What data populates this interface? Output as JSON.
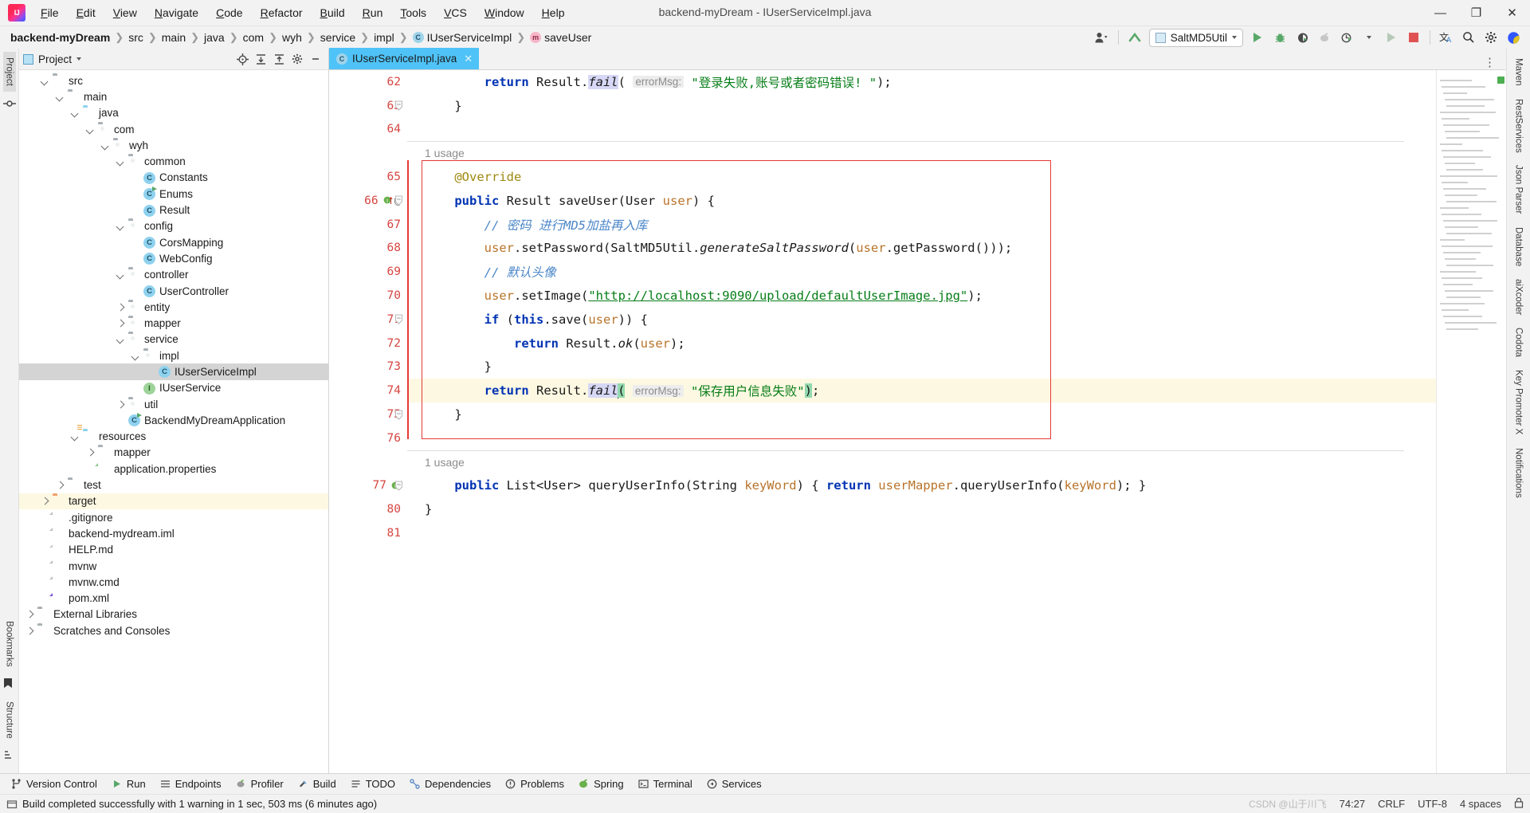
{
  "window": {
    "title": "backend-myDream - IUserServiceImpl.java",
    "logo_icon": "intellij-idea-logo",
    "minimize_icon": "minimize-icon",
    "maximize_icon": "maximize-icon",
    "close_icon": "close-icon",
    "minimize_glyph": "—",
    "maximize_glyph": "❐",
    "close_glyph": "✕"
  },
  "menubar": {
    "items": [
      "File",
      "Edit",
      "View",
      "Navigate",
      "Code",
      "Refactor",
      "Build",
      "Run",
      "Tools",
      "VCS",
      "Window",
      "Help"
    ]
  },
  "navbar": {
    "crumbs": [
      {
        "label": "backend-myDream",
        "icon": "",
        "bold": true
      },
      {
        "label": "src",
        "icon": ""
      },
      {
        "label": "main",
        "icon": ""
      },
      {
        "label": "java",
        "icon": ""
      },
      {
        "label": "com",
        "icon": ""
      },
      {
        "label": "wyh",
        "icon": ""
      },
      {
        "label": "service",
        "icon": ""
      },
      {
        "label": "impl",
        "icon": ""
      },
      {
        "label": "IUserServiceImpl",
        "icon": "class-badge",
        "badge": "C"
      },
      {
        "label": "saveUser",
        "icon": "method-badge",
        "badge": "m"
      }
    ],
    "separator": "❯",
    "run_config": "SaltMD5Util",
    "icons": [
      "account-icon",
      "updates-icon",
      "run-icon",
      "debug-icon",
      "run-coverage-icon",
      "profiler-icon",
      "run-with-timer-icon",
      "rerun-icon",
      "stop-icon",
      "translate-icon",
      "search-icon",
      "settings-icon",
      "ai-assistant-icon"
    ]
  },
  "left_rail": {
    "tabs": [
      "Project",
      "Commit"
    ],
    "active": "Project",
    "bottom_tabs": [
      "Bookmarks",
      "Structure"
    ]
  },
  "right_rail": {
    "tabs": [
      "Maven",
      "RestServices",
      "Json Parser",
      "Database",
      "aiXcoder",
      "Codota",
      "Key Promoter X",
      "Notifications"
    ]
  },
  "project_panel": {
    "title": "Project",
    "dropdown_icon": "chevron-down-icon",
    "actions": [
      "locate-icon",
      "expand-all-icon",
      "collapse-all-icon",
      "settings-icon",
      "hide-icon"
    ],
    "tree": [
      {
        "label": "src",
        "depth": 1,
        "arrow": "down",
        "icon": "folder",
        "kind": "folder"
      },
      {
        "label": "main",
        "depth": 2,
        "arrow": "down",
        "icon": "folder",
        "kind": "folder"
      },
      {
        "label": "java",
        "depth": 3,
        "arrow": "down",
        "icon": "folder-source",
        "kind": "folder"
      },
      {
        "label": "com",
        "depth": 4,
        "arrow": "down",
        "icon": "folder-package",
        "kind": "folder"
      },
      {
        "label": "wyh",
        "depth": 5,
        "arrow": "down",
        "icon": "folder-package",
        "kind": "folder"
      },
      {
        "label": "common",
        "depth": 6,
        "arrow": "down",
        "icon": "folder-package",
        "kind": "folder"
      },
      {
        "label": "Constants",
        "depth": 7,
        "arrow": "",
        "icon": "class",
        "kind": "class"
      },
      {
        "label": "Enums",
        "depth": 7,
        "arrow": "",
        "icon": "class-run",
        "kind": "class-run"
      },
      {
        "label": "Result",
        "depth": 7,
        "arrow": "",
        "icon": "class",
        "kind": "class"
      },
      {
        "label": "config",
        "depth": 6,
        "arrow": "down",
        "icon": "folder-package",
        "kind": "folder"
      },
      {
        "label": "CorsMapping",
        "depth": 7,
        "arrow": "",
        "icon": "class",
        "kind": "class"
      },
      {
        "label": "WebConfig",
        "depth": 7,
        "arrow": "",
        "icon": "class",
        "kind": "class"
      },
      {
        "label": "controller",
        "depth": 6,
        "arrow": "down",
        "icon": "folder-package",
        "kind": "folder"
      },
      {
        "label": "UserController",
        "depth": 7,
        "arrow": "",
        "icon": "class",
        "kind": "class"
      },
      {
        "label": "entity",
        "depth": 6,
        "arrow": "right",
        "icon": "folder-package",
        "kind": "folder"
      },
      {
        "label": "mapper",
        "depth": 6,
        "arrow": "right",
        "icon": "folder-package",
        "kind": "folder"
      },
      {
        "label": "service",
        "depth": 6,
        "arrow": "down",
        "icon": "folder-package",
        "kind": "folder"
      },
      {
        "label": "impl",
        "depth": 7,
        "arrow": "down",
        "icon": "folder-package",
        "kind": "folder"
      },
      {
        "label": "IUserServiceImpl",
        "depth": 8,
        "arrow": "",
        "icon": "class",
        "kind": "class",
        "selected": true
      },
      {
        "label": "IUserService",
        "depth": 7,
        "arrow": "",
        "icon": "interface",
        "kind": "interface"
      },
      {
        "label": "util",
        "depth": 6,
        "arrow": "right",
        "icon": "folder-package",
        "kind": "folder"
      },
      {
        "label": "BackendMyDreamApplication",
        "depth": 6,
        "arrow": "",
        "icon": "class-spring",
        "kind": "class-run"
      },
      {
        "label": "resources",
        "depth": 3,
        "arrow": "down",
        "icon": "folder-resource",
        "kind": "folder"
      },
      {
        "label": "mapper",
        "depth": 4,
        "arrow": "right",
        "icon": "folder",
        "kind": "folder"
      },
      {
        "label": "application.properties",
        "depth": 4,
        "arrow": "",
        "icon": "file-properties",
        "kind": "file"
      },
      {
        "label": "test",
        "depth": 2,
        "arrow": "right",
        "icon": "folder",
        "kind": "folder"
      },
      {
        "label": "target",
        "depth": 1,
        "arrow": "right",
        "icon": "folder-target",
        "kind": "folder",
        "highlight": true
      },
      {
        "label": ".gitignore",
        "depth": 1,
        "arrow": "",
        "icon": "file-ignore",
        "kind": "file"
      },
      {
        "label": "backend-mydream.iml",
        "depth": 1,
        "arrow": "",
        "icon": "file-iml",
        "kind": "file"
      },
      {
        "label": "HELP.md",
        "depth": 1,
        "arrow": "",
        "icon": "file-md",
        "kind": "file"
      },
      {
        "label": "mvnw",
        "depth": 1,
        "arrow": "",
        "icon": "file",
        "kind": "file"
      },
      {
        "label": "mvnw.cmd",
        "depth": 1,
        "arrow": "",
        "icon": "file",
        "kind": "file"
      },
      {
        "label": "pom.xml",
        "depth": 1,
        "arrow": "",
        "icon": "file-maven",
        "kind": "file"
      },
      {
        "label": "External Libraries",
        "depth": 0,
        "arrow": "right",
        "icon": "library",
        "kind": "library"
      },
      {
        "label": "Scratches and Consoles",
        "depth": 0,
        "arrow": "right",
        "icon": "scratch",
        "kind": "library"
      }
    ]
  },
  "editor": {
    "tab": {
      "label": "IUserServiceImpl.java",
      "badge": "C",
      "close_glyph": "✕"
    },
    "kebab_glyph": "⋮",
    "usage_label_1": "1 usage",
    "usage_label_2": "1 usage",
    "caret_position": "74:27",
    "lines": [
      {
        "num": "62",
        "indent": 2,
        "tokens": [
          {
            "t": "return ",
            "c": "kw"
          },
          {
            "t": "Result.",
            "c": "typ"
          },
          {
            "t": "fail",
            "c": "mth sel-tok"
          },
          {
            "t": "( ",
            "c": "typ"
          },
          {
            "t": "errorMsg:",
            "c": "hint"
          },
          {
            "t": " ",
            "c": "typ"
          },
          {
            "t": "\"登录失败,账号或者密码错误! \"",
            "c": "str"
          },
          {
            "t": ");",
            "c": "typ"
          }
        ]
      },
      {
        "num": "63",
        "indent": 1,
        "fold": true,
        "tokens": [
          {
            "t": "}",
            "c": "typ"
          }
        ]
      },
      {
        "num": "64",
        "indent": 0,
        "tokens": []
      },
      {
        "num": "",
        "usage": "1 usage",
        "sep": true
      },
      {
        "num": "65",
        "indent": 1,
        "box_start": true,
        "tokens": [
          {
            "t": "@Override",
            "c": "ann"
          }
        ]
      },
      {
        "num": "66",
        "indent": 1,
        "fold": true,
        "gutter_mark": "override-impl",
        "tokens": [
          {
            "t": "public ",
            "c": "kw"
          },
          {
            "t": "Result ",
            "c": "typ"
          },
          {
            "t": "saveUser",
            "c": "typ"
          },
          {
            "t": "(",
            "c": "typ"
          },
          {
            "t": "User ",
            "c": "typ"
          },
          {
            "t": "user",
            "c": "prm"
          },
          {
            "t": ") {",
            "c": "typ"
          }
        ]
      },
      {
        "num": "67",
        "indent": 2,
        "tokens": [
          {
            "t": "// 密码 进行MD5加盐再入库",
            "c": "cmt"
          }
        ]
      },
      {
        "num": "68",
        "indent": 2,
        "tokens": [
          {
            "t": "user",
            "c": "prm"
          },
          {
            "t": ".setPassword(SaltMD5Util.",
            "c": "typ"
          },
          {
            "t": "generateSaltPassword",
            "c": "mth"
          },
          {
            "t": "(",
            "c": "typ"
          },
          {
            "t": "user",
            "c": "prm"
          },
          {
            "t": ".getPassword()));",
            "c": "typ"
          }
        ]
      },
      {
        "num": "69",
        "indent": 2,
        "tokens": [
          {
            "t": "// 默认头像",
            "c": "cmt"
          }
        ]
      },
      {
        "num": "70",
        "indent": 2,
        "tokens": [
          {
            "t": "user",
            "c": "prm"
          },
          {
            "t": ".setImage(",
            "c": "typ"
          },
          {
            "t": "\"http://localhost:9090/upload/defaultUserImage.jpg\"",
            "c": "str link"
          },
          {
            "t": ");",
            "c": "typ"
          }
        ]
      },
      {
        "num": "71",
        "indent": 2,
        "fold": true,
        "tokens": [
          {
            "t": "if ",
            "c": "kw"
          },
          {
            "t": "(",
            "c": "typ"
          },
          {
            "t": "this",
            "c": "kw"
          },
          {
            "t": ".save(",
            "c": "typ"
          },
          {
            "t": "user",
            "c": "prm"
          },
          {
            "t": ")) {",
            "c": "typ"
          }
        ]
      },
      {
        "num": "72",
        "indent": 3,
        "tokens": [
          {
            "t": "return ",
            "c": "kw"
          },
          {
            "t": "Result.",
            "c": "typ"
          },
          {
            "t": "ok",
            "c": "mth"
          },
          {
            "t": "(",
            "c": "typ"
          },
          {
            "t": "user",
            "c": "prm"
          },
          {
            "t": ");",
            "c": "typ"
          }
        ]
      },
      {
        "num": "73",
        "indent": 2,
        "tokens": [
          {
            "t": "}",
            "c": "typ"
          }
        ]
      },
      {
        "num": "74",
        "indent": 2,
        "caret_line": true,
        "tokens": [
          {
            "t": "return ",
            "c": "kw"
          },
          {
            "t": "Result.",
            "c": "typ"
          },
          {
            "t": "fail",
            "c": "mth sel-tok"
          },
          {
            "t": "CARET",
            "c": "caret"
          },
          {
            "t": "(",
            "c": "brk"
          },
          {
            "t": " ",
            "c": "typ"
          },
          {
            "t": "errorMsg:",
            "c": "hint"
          },
          {
            "t": " ",
            "c": "typ"
          },
          {
            "t": "\"保存用户信息失败\"",
            "c": "str"
          },
          {
            "t": ")",
            "c": "brk"
          },
          {
            "t": ";",
            "c": "typ"
          }
        ]
      },
      {
        "num": "75",
        "indent": 1,
        "fold": true,
        "box_end": true,
        "tokens": [
          {
            "t": "}",
            "c": "typ"
          }
        ]
      },
      {
        "num": "76",
        "indent": 0,
        "tokens": []
      },
      {
        "num": "",
        "usage": "1 usage",
        "sep": true
      },
      {
        "num": "77",
        "indent": 1,
        "fold": true,
        "gutter_mark": "impl",
        "tokens": [
          {
            "t": "public ",
            "c": "kw"
          },
          {
            "t": "List<User> ",
            "c": "typ"
          },
          {
            "t": "queryUserInfo",
            "c": "typ"
          },
          {
            "t": "(",
            "c": "typ"
          },
          {
            "t": "String ",
            "c": "typ"
          },
          {
            "t": "keyWord",
            "c": "prm"
          },
          {
            "t": ") { ",
            "c": "typ"
          },
          {
            "t": "return ",
            "c": "kw"
          },
          {
            "t": "userMapper",
            "c": "prm"
          },
          {
            "t": ".queryUserInfo(",
            "c": "typ"
          },
          {
            "t": "keyWord",
            "c": "prm"
          },
          {
            "t": "); }",
            "c": "typ"
          }
        ]
      },
      {
        "num": "80",
        "indent": 0,
        "tokens": [
          {
            "t": "}",
            "c": "typ"
          }
        ]
      },
      {
        "num": "81",
        "indent": 0,
        "tokens": []
      }
    ],
    "red_box": {
      "present": true,
      "color": "#e53935"
    }
  },
  "bottom_toolwindows": [
    {
      "label": "Version Control",
      "icon": "branch-icon"
    },
    {
      "label": "Run",
      "icon": "run-icon"
    },
    {
      "label": "Endpoints",
      "icon": "endpoints-icon"
    },
    {
      "label": "Profiler",
      "icon": "profiler-icon"
    },
    {
      "label": "Build",
      "icon": "build-icon"
    },
    {
      "label": "TODO",
      "icon": "todo-icon"
    },
    {
      "label": "Dependencies",
      "icon": "dependencies-icon"
    },
    {
      "label": "Problems",
      "icon": "problems-icon"
    },
    {
      "label": "Spring",
      "icon": "spring-icon"
    },
    {
      "label": "Terminal",
      "icon": "terminal-icon"
    },
    {
      "label": "Services",
      "icon": "services-icon"
    }
  ],
  "statusbar": {
    "message": "Build completed successfully with 1 warning in 1 sec, 503 ms (6 minutes ago)",
    "message_icon": "build-status-icon",
    "caret": "74:27",
    "line_sep": "CRLF",
    "encoding": "UTF-8",
    "indent": "4 spaces",
    "lock_icon": "lock-icon",
    "watermark": "CSDN @山于川飞"
  },
  "colors": {
    "accent": "#4fc3f7",
    "keyword": "#0033b3",
    "string": "#067d17",
    "comment": "#4a86c8",
    "param": "#b8742a",
    "annotation": "#9e880d",
    "gutter_number": "#d64541",
    "highlight_box": "#e53935",
    "caret_line": "#fdf8e2",
    "selection": "#d7d8f5"
  }
}
